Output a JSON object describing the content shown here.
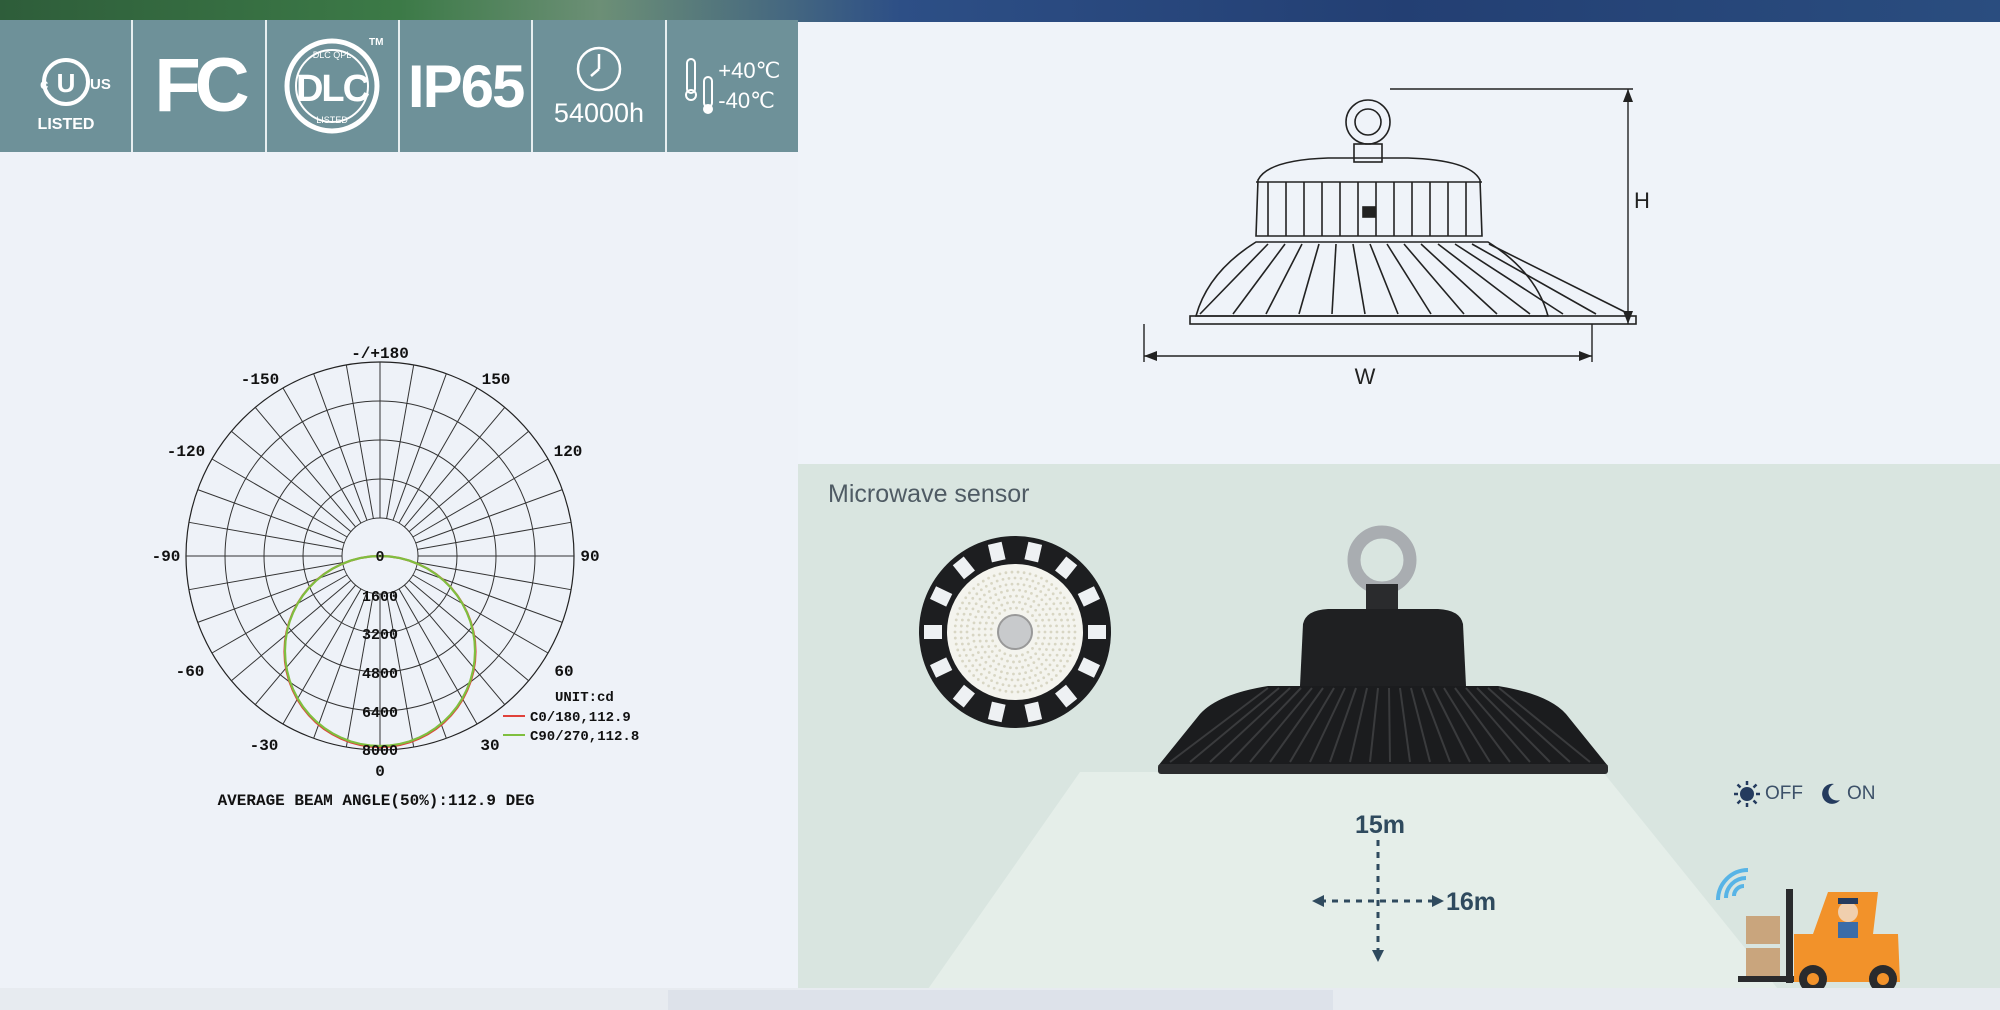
{
  "certifications": {
    "ul": {
      "c": "c",
      "us": "US",
      "listed": "LISTED"
    },
    "fc": "FC",
    "dlc": {
      "top": "DLC QPL",
      "tm": "TM",
      "bottom": "LISTED"
    },
    "ip_rating": "IP65",
    "lifetime": "54000h",
    "temp_high": "+40℃",
    "temp_low": "-40℃"
  },
  "polar": {
    "angles": {
      "top": "-/+180",
      "m150": "-150",
      "p150": "150",
      "m120": "-120",
      "p120": "120",
      "m90": "-90",
      "p90": "90",
      "m60": "-60",
      "p60": "60",
      "m30": "-30",
      "p30": "30",
      "bottom": "0",
      "center": "0"
    },
    "radials": [
      "1600",
      "3200",
      "4800",
      "6400",
      "8000"
    ],
    "unit": "UNIT:cd",
    "legend": [
      {
        "label": "C0/180,112.9",
        "color": "#e0413a"
      },
      {
        "label": "C90/270,112.8",
        "color": "#7fbf3f"
      }
    ],
    "caption": "AVERAGE BEAM ANGLE(50%):112.9 DEG"
  },
  "dimension_drawing": {
    "height_label": "H",
    "width_label": "W"
  },
  "sensor": {
    "title": "Microwave sensor",
    "height_range": "15m",
    "horizontal_range": "16m",
    "off_label": "OFF",
    "on_label": "ON"
  }
}
